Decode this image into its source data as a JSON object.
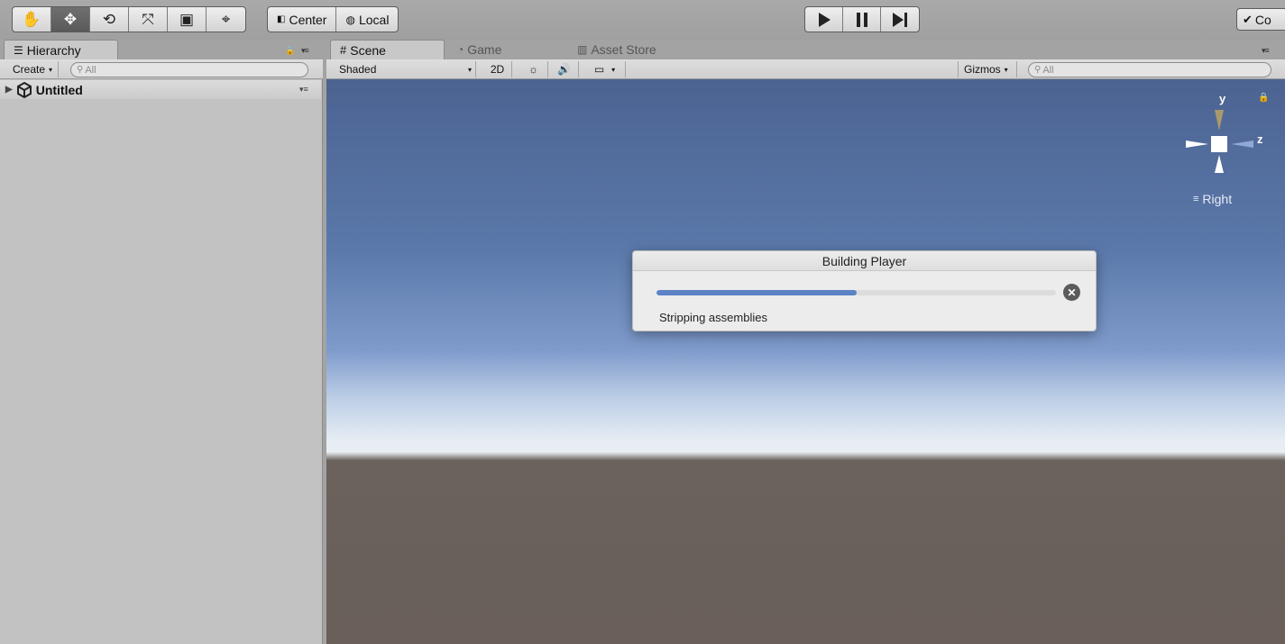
{
  "toolbar": {
    "transform_tools": [
      {
        "name": "hand-tool",
        "icon": "hand-icon",
        "glyph": "✋"
      },
      {
        "name": "move-tool",
        "icon": "move-arrows-icon",
        "glyph": "✥"
      },
      {
        "name": "rotate-tool",
        "icon": "rotate-icon",
        "glyph": "⟲"
      },
      {
        "name": "scale-tool",
        "icon": "scale-icon",
        "glyph": "⤧"
      },
      {
        "name": "rect-tool",
        "icon": "rect-tool-icon",
        "glyph": "▣"
      },
      {
        "name": "transform-tool",
        "icon": "transform-gizmo-icon",
        "glyph": "⌖"
      }
    ],
    "active_tool_index": 1,
    "pivot_label": "Center",
    "rotation_label": "Local",
    "collab_label": "Co"
  },
  "hierarchy": {
    "tab_label": "Hierarchy",
    "create_label": "Create",
    "search_placeholder": "All",
    "scene_name": "Untitled"
  },
  "scene_tabs": {
    "scene_label": "Scene",
    "game_label": "Game",
    "asset_store_label": "Asset Store"
  },
  "scene_toolbar": {
    "shading_mode": "Shaded",
    "mode_2d_label": "2D",
    "gizmos_label": "Gizmos",
    "search_placeholder": "All"
  },
  "scene_gizmo": {
    "y_label": "y",
    "z_label": "z",
    "view_label": "Right"
  },
  "dialog": {
    "title": "Building Player",
    "status": "Stripping assemblies",
    "progress": 0.5
  },
  "colors": {
    "progress_fill": "#5b83c6",
    "sky_top": "#4c6391",
    "ground": "#6a5f59",
    "panel_bg": "#c2c2c2"
  }
}
